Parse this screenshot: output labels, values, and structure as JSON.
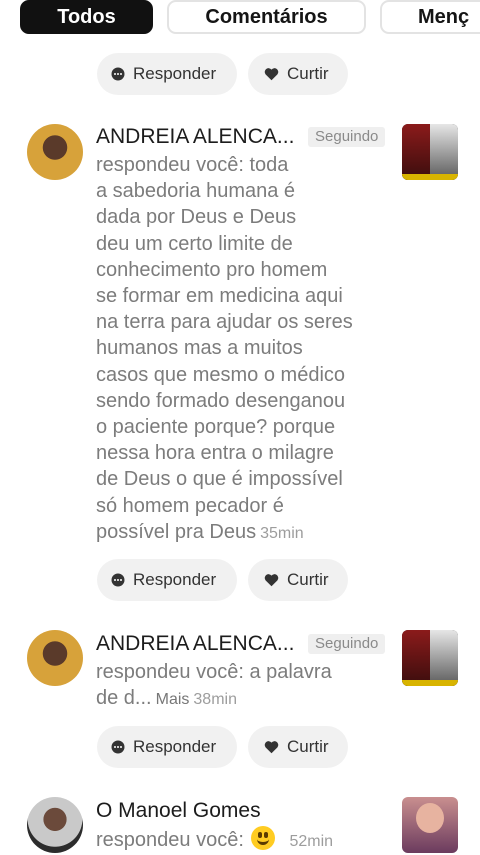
{
  "tabs": [
    "Todos",
    "Comentários",
    "Menç"
  ],
  "actions": {
    "reply_label": "Responder",
    "like_label": "Curtir"
  },
  "notifications": [
    {
      "name": "ANDREIA ALENCA...",
      "badge": "Seguindo",
      "lines": [
        "respondeu você: toda",
        "a sabedoria humana é",
        "dada por Deus e Deus",
        "deu um certo limite de",
        "conhecimento pro homem",
        "se formar em medicina aqui",
        "na terra para ajudar os seres",
        "humanos mas a muitos",
        "casos que mesmo o médico",
        "sendo formado desenganou",
        "o paciente porque? porque",
        "nessa hora entra o milagre",
        "de Deus o que é impossível",
        "só homem pecador é",
        "possível pra Deus"
      ],
      "time": "35min"
    },
    {
      "name": "ANDREIA ALENCA...",
      "badge": "Seguindo",
      "lines": [
        "respondeu você: a palavra",
        "de d..."
      ],
      "more": "Mais",
      "time": "38min"
    },
    {
      "name": "O Manoel Gomes",
      "lines": [
        "respondeu você:"
      ],
      "time": "52min"
    }
  ]
}
